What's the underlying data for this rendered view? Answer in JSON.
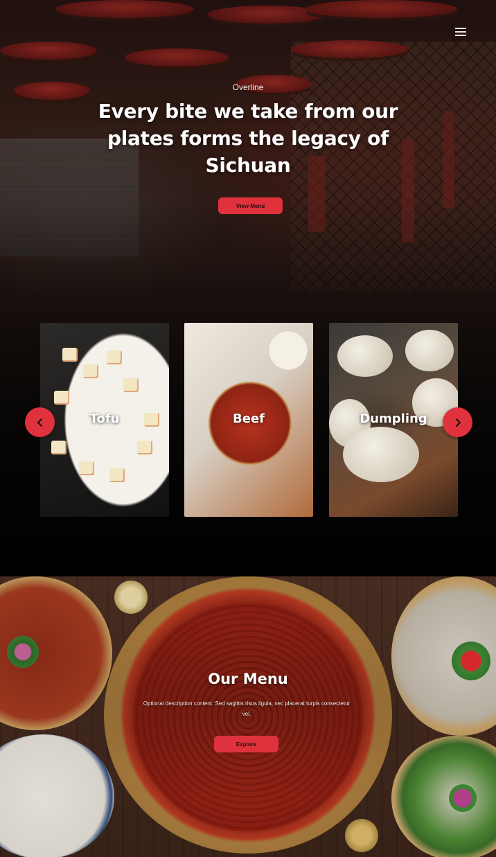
{
  "header": {
    "menu_icon": "hamburger-menu-icon"
  },
  "hero": {
    "overline": "Overline",
    "title": "Every bite we take from our plates forms the legacy of Sichuan",
    "cta_label": "View Menu"
  },
  "carousel": {
    "prev_icon": "chevron-left-icon",
    "next_icon": "chevron-right-icon",
    "items": [
      {
        "label": "Tofu"
      },
      {
        "label": "Beef"
      },
      {
        "label": "Dumpling"
      }
    ]
  },
  "menu_section": {
    "title": "Our Menu",
    "description": "Optional description content. Sed sagittis risus ligula, nec placerat turpis consectetur vel.",
    "cta_label": "Explore"
  },
  "colors": {
    "accent": "#e0323d",
    "background": "#0d0c0c",
    "text": "#ffffff"
  }
}
